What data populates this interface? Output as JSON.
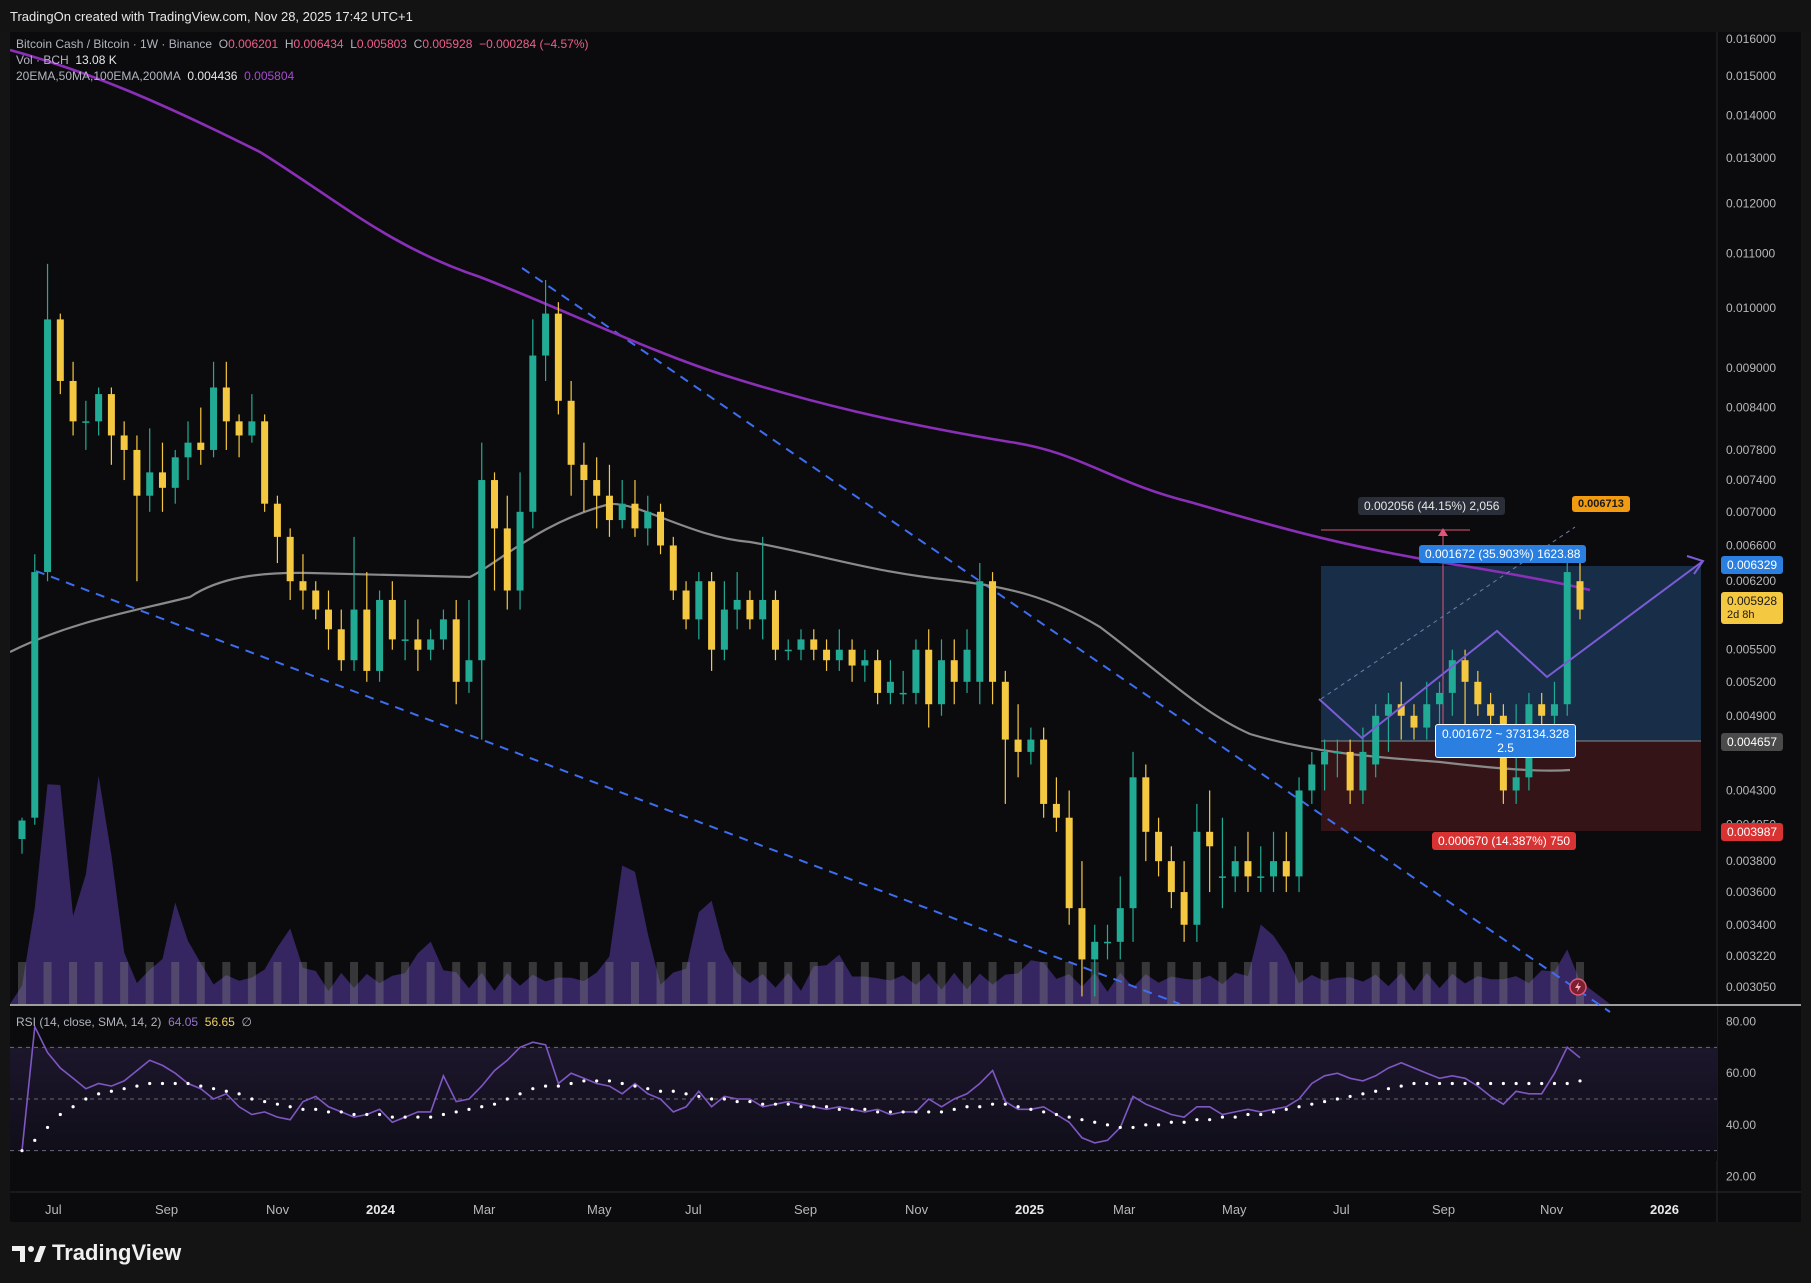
{
  "header": {
    "caption": "TradingOn created with TradingView.com, Nov 28, 2025 17:42 UTC+1"
  },
  "legend": {
    "symbol": "Bitcoin Cash / Bitcoin · 1W · Binance",
    "o_label": "O",
    "o_value": "0.006201",
    "h_label": "H",
    "h_value": "0.006434",
    "l_label": "L",
    "l_value": "0.005803",
    "c_label": "C",
    "c_value": "0.005928",
    "change": "−0.000284 (−4.57%)",
    "vol_label": "Vol · BCH",
    "vol_value": "13.08 K",
    "ma_label": "20EMA,50MA,100EMA,200MA",
    "ma_value1": "0.004436",
    "ma_value2": "0.005804",
    "rsi_label": "RSI (14, close, SMA, 14, 2)",
    "rsi_value": "64.05",
    "rsi_sma": "56.65",
    "rsi_extra": "∅"
  },
  "tags": {
    "range_top": "0.002056 (44.15%) 2,056",
    "target_price": "0.006713",
    "target_box": "0.001672 (35.903%) 1623.88",
    "ratio_line1": "0.001672 ~ 373134.328",
    "ratio_line2": "2.5",
    "stop_box": "0.000670 (14.387%) 750",
    "price_6329": "0.006329",
    "price_last": "0.005928",
    "countdown": "2d 8h",
    "price_4657": "0.004657",
    "price_3987": "0.003987"
  },
  "brand": {
    "name": "TradingView"
  },
  "colors": {
    "up": "#22ab94",
    "down": "#f5c842",
    "ma_purple": "#8b2fb8",
    "ma_grey": "#8a8a8a",
    "trend_blue": "#3d6ef0",
    "rsi": "#7e57c2",
    "target_zone": "#1e3b5c",
    "stop_zone": "#3a1518"
  },
  "chart_data": {
    "type": "candlestick",
    "price_scale": "log",
    "ylim": [
      0.00296,
      0.0162
    ],
    "y_ticks": [
      "0.016000",
      "0.015000",
      "0.014000",
      "0.013000",
      "0.012000",
      "0.011000",
      "0.010000",
      "0.009000",
      "0.008400",
      "0.007800",
      "0.007400",
      "0.007000",
      "0.006600",
      "0.006200",
      "0.005500",
      "0.005200",
      "0.004900",
      "0.004300",
      "0.004050",
      "0.003800",
      "0.003600",
      "0.003400",
      "0.003220",
      "0.003050"
    ],
    "x_ticks": [
      "Jul",
      "Sep",
      "Nov",
      "2024",
      "Mar",
      "May",
      "Jul",
      "Sep",
      "Nov",
      "2025",
      "Mar",
      "May",
      "Jul",
      "Sep",
      "Nov",
      "2026"
    ],
    "rsi_ticks": [
      "80.00",
      "60.00",
      "40.00",
      "20.00"
    ],
    "candles": [
      [
        0.00395,
        0.00408,
        0.00385,
        0.0041
      ],
      [
        0.0041,
        0.0063,
        0.00405,
        0.0065
      ],
      [
        0.0063,
        0.0098,
        0.0062,
        0.0108
      ],
      [
        0.0098,
        0.0088,
        0.0086,
        0.0099
      ],
      [
        0.0088,
        0.0082,
        0.008,
        0.0091
      ],
      [
        0.0082,
        0.0082,
        0.0078,
        0.0085
      ],
      [
        0.0082,
        0.0086,
        0.008,
        0.0087
      ],
      [
        0.0086,
        0.008,
        0.0076,
        0.0087
      ],
      [
        0.008,
        0.0078,
        0.0074,
        0.0082
      ],
      [
        0.0078,
        0.0072,
        0.0062,
        0.008
      ],
      [
        0.0072,
        0.0075,
        0.007,
        0.0081
      ],
      [
        0.0075,
        0.0073,
        0.007,
        0.0079
      ],
      [
        0.0073,
        0.0077,
        0.0071,
        0.0078
      ],
      [
        0.0077,
        0.0079,
        0.0074,
        0.0082
      ],
      [
        0.0079,
        0.0078,
        0.0076,
        0.0084
      ],
      [
        0.0078,
        0.0087,
        0.0077,
        0.0091
      ],
      [
        0.0087,
        0.0082,
        0.0078,
        0.0091
      ],
      [
        0.0082,
        0.008,
        0.0077,
        0.0083
      ],
      [
        0.008,
        0.0082,
        0.0079,
        0.0086
      ],
      [
        0.0082,
        0.0071,
        0.007,
        0.0083
      ],
      [
        0.0071,
        0.0067,
        0.0064,
        0.0072
      ],
      [
        0.0067,
        0.0062,
        0.006,
        0.0068
      ],
      [
        0.0062,
        0.0061,
        0.0059,
        0.0065
      ],
      [
        0.0061,
        0.0059,
        0.0058,
        0.0062
      ],
      [
        0.0059,
        0.0057,
        0.0055,
        0.0061
      ],
      [
        0.0057,
        0.0054,
        0.0053,
        0.0059
      ],
      [
        0.0054,
        0.0059,
        0.0053,
        0.0067
      ],
      [
        0.0059,
        0.0053,
        0.0052,
        0.0063
      ],
      [
        0.0053,
        0.006,
        0.0052,
        0.0061
      ],
      [
        0.006,
        0.0056,
        0.0055,
        0.0062
      ],
      [
        0.0056,
        0.0056,
        0.0054,
        0.006
      ],
      [
        0.0056,
        0.0055,
        0.0053,
        0.0058
      ],
      [
        0.0055,
        0.0056,
        0.0054,
        0.0057
      ],
      [
        0.0056,
        0.0058,
        0.0055,
        0.0059
      ],
      [
        0.0058,
        0.0052,
        0.005,
        0.006
      ],
      [
        0.0052,
        0.0054,
        0.0051,
        0.006
      ],
      [
        0.0054,
        0.0074,
        0.0047,
        0.0079
      ],
      [
        0.0074,
        0.0068,
        0.0061,
        0.0075
      ],
      [
        0.0068,
        0.0061,
        0.0059,
        0.0072
      ],
      [
        0.0061,
        0.007,
        0.0059,
        0.0075
      ],
      [
        0.007,
        0.0092,
        0.0068,
        0.0098
      ],
      [
        0.0092,
        0.0099,
        0.0088,
        0.0105
      ],
      [
        0.0099,
        0.0085,
        0.0083,
        0.0101
      ],
      [
        0.0085,
        0.0076,
        0.0072,
        0.0088
      ],
      [
        0.0076,
        0.0074,
        0.007,
        0.0079
      ],
      [
        0.0074,
        0.0072,
        0.0068,
        0.0077
      ],
      [
        0.0072,
        0.0069,
        0.0067,
        0.0076
      ],
      [
        0.0069,
        0.0071,
        0.0068,
        0.0074
      ],
      [
        0.0071,
        0.0068,
        0.0067,
        0.0074
      ],
      [
        0.0068,
        0.007,
        0.0066,
        0.0072
      ],
      [
        0.007,
        0.0066,
        0.0065,
        0.0071
      ],
      [
        0.0066,
        0.0061,
        0.006,
        0.0067
      ],
      [
        0.0061,
        0.0058,
        0.0057,
        0.0062
      ],
      [
        0.0058,
        0.0062,
        0.0056,
        0.0063
      ],
      [
        0.0062,
        0.0055,
        0.0053,
        0.0063
      ],
      [
        0.0055,
        0.0059,
        0.0054,
        0.0062
      ],
      [
        0.0059,
        0.006,
        0.0057,
        0.0063
      ],
      [
        0.006,
        0.0058,
        0.0057,
        0.0061
      ],
      [
        0.0058,
        0.006,
        0.0056,
        0.0067
      ],
      [
        0.006,
        0.0055,
        0.0054,
        0.0061
      ],
      [
        0.0055,
        0.0055,
        0.0054,
        0.0056
      ],
      [
        0.0055,
        0.0056,
        0.0054,
        0.0057
      ],
      [
        0.0056,
        0.0055,
        0.0054,
        0.0057
      ],
      [
        0.0055,
        0.0054,
        0.0053,
        0.0056
      ],
      [
        0.0054,
        0.0055,
        0.0053,
        0.0057
      ],
      [
        0.0055,
        0.00535,
        0.0052,
        0.0056
      ],
      [
        0.00535,
        0.0054,
        0.0052,
        0.0055
      ],
      [
        0.0054,
        0.0051,
        0.005,
        0.0055
      ],
      [
        0.0051,
        0.0052,
        0.005,
        0.0054
      ],
      [
        0.0051,
        0.0051,
        0.005,
        0.0053
      ],
      [
        0.0051,
        0.0055,
        0.005,
        0.0056
      ],
      [
        0.0055,
        0.005,
        0.0048,
        0.0057
      ],
      [
        0.005,
        0.0054,
        0.0049,
        0.0056
      ],
      [
        0.0054,
        0.0052,
        0.005,
        0.0056
      ],
      [
        0.0052,
        0.0055,
        0.0051,
        0.0057
      ],
      [
        0.0052,
        0.0062,
        0.005,
        0.0064
      ],
      [
        0.0062,
        0.0052,
        0.005,
        0.0063
      ],
      [
        0.0052,
        0.0047,
        0.0042,
        0.0053
      ],
      [
        0.0047,
        0.0046,
        0.0044,
        0.005
      ],
      [
        0.0046,
        0.0047,
        0.0045,
        0.0048
      ],
      [
        0.0047,
        0.0042,
        0.0041,
        0.0048
      ],
      [
        0.0042,
        0.0041,
        0.004,
        0.0044
      ],
      [
        0.0041,
        0.0035,
        0.0034,
        0.0043
      ],
      [
        0.0035,
        0.0032,
        0.003,
        0.0038
      ],
      [
        0.0032,
        0.0033,
        0.003,
        0.0034
      ],
      [
        0.0033,
        0.0033,
        0.0032,
        0.0034
      ],
      [
        0.0033,
        0.0035,
        0.0032,
        0.0037
      ],
      [
        0.0035,
        0.0044,
        0.0033,
        0.0046
      ],
      [
        0.0044,
        0.004,
        0.0038,
        0.0045
      ],
      [
        0.004,
        0.0038,
        0.0037,
        0.0041
      ],
      [
        0.0038,
        0.0036,
        0.0035,
        0.0039
      ],
      [
        0.0036,
        0.0034,
        0.0033,
        0.0038
      ],
      [
        0.0034,
        0.004,
        0.0033,
        0.0042
      ],
      [
        0.004,
        0.0039,
        0.0036,
        0.0043
      ],
      [
        0.0037,
        0.0037,
        0.0035,
        0.0041
      ],
      [
        0.0037,
        0.0038,
        0.0036,
        0.0039
      ],
      [
        0.0038,
        0.0037,
        0.0036,
        0.004
      ],
      [
        0.0037,
        0.0037,
        0.0036,
        0.0039
      ],
      [
        0.0037,
        0.0038,
        0.0036,
        0.004
      ],
      [
        0.0038,
        0.0037,
        0.0036,
        0.004
      ],
      [
        0.0037,
        0.0043,
        0.0036,
        0.0044
      ],
      [
        0.0043,
        0.0045,
        0.0042,
        0.0046
      ],
      [
        0.0045,
        0.0046,
        0.0043,
        0.0047
      ],
      [
        0.0046,
        0.0046,
        0.0044,
        0.0047
      ],
      [
        0.0046,
        0.0043,
        0.0042,
        0.0047
      ],
      [
        0.0043,
        0.0046,
        0.0042,
        0.0048
      ],
      [
        0.0045,
        0.0049,
        0.0044,
        0.005
      ],
      [
        0.0049,
        0.005,
        0.0046,
        0.0051
      ],
      [
        0.005,
        0.0049,
        0.0047,
        0.0052
      ],
      [
        0.0049,
        0.0048,
        0.0047,
        0.005
      ],
      [
        0.0048,
        0.005,
        0.0047,
        0.0052
      ],
      [
        0.005,
        0.0051,
        0.0048,
        0.0052
      ],
      [
        0.0051,
        0.0054,
        0.0049,
        0.0055
      ],
      [
        0.0054,
        0.0052,
        0.0047,
        0.0055
      ],
      [
        0.0052,
        0.005,
        0.0049,
        0.0053
      ],
      [
        0.005,
        0.0049,
        0.0047,
        0.0051
      ],
      [
        0.0049,
        0.0043,
        0.0042,
        0.005
      ],
      [
        0.0043,
        0.0044,
        0.0042,
        0.005
      ],
      [
        0.0044,
        0.005,
        0.0043,
        0.0051
      ],
      [
        0.005,
        0.0049,
        0.0047,
        0.0051
      ],
      [
        0.0049,
        0.005,
        0.0047,
        0.0052
      ],
      [
        0.005,
        0.0063,
        0.0049,
        0.0064
      ],
      [
        0.0062,
        0.0059,
        0.0058,
        0.0064
      ]
    ],
    "volume_peaks": [
      [
        0.02,
        0.95
      ],
      [
        0.05,
        0.85
      ],
      [
        0.1,
        0.3
      ],
      [
        0.17,
        0.2
      ],
      [
        0.26,
        0.15
      ],
      [
        0.39,
        0.55
      ],
      [
        0.44,
        0.35
      ],
      [
        0.52,
        0.1
      ],
      [
        0.65,
        0.08
      ],
      [
        0.8,
        0.25
      ],
      [
        0.99,
        0.1
      ]
    ],
    "rsi_values": [
      30,
      78,
      68,
      62,
      58,
      54,
      56,
      55,
      57,
      61,
      65,
      63,
      60,
      56,
      54,
      50,
      52,
      47,
      44,
      45,
      43,
      42,
      49,
      51,
      47,
      45,
      43,
      44,
      46,
      41,
      43,
      45,
      45,
      59,
      49,
      50,
      55,
      61,
      65,
      70,
      72,
      71,
      56,
      60,
      58,
      56,
      55,
      52,
      56,
      52,
      50,
      45,
      47,
      53,
      47,
      51,
      50,
      50,
      47,
      48,
      49,
      48,
      47,
      46,
      47,
      46,
      45,
      46,
      44,
      45,
      45,
      50,
      47,
      50,
      52,
      56,
      61,
      49,
      46,
      46,
      47,
      44,
      41,
      35,
      33,
      34,
      39,
      51,
      48,
      46,
      44,
      43,
      47,
      47,
      44,
      45,
      46,
      45,
      46,
      47,
      50,
      56,
      59,
      60,
      58,
      57,
      59,
      62,
      64,
      62,
      60,
      58,
      59,
      58,
      55,
      51,
      48,
      53,
      52,
      52,
      60,
      70,
      66
    ],
    "rsi_sma_values": [
      30,
      34,
      39,
      44,
      47,
      50,
      52,
      53,
      54,
      55,
      56,
      56,
      56,
      56,
      55,
      54,
      53,
      52,
      50,
      49,
      48,
      47,
      46,
      46,
      45,
      45,
      44,
      44,
      44,
      43,
      43,
      43,
      43,
      44,
      45,
      46,
      47,
      48,
      50,
      52,
      54,
      55,
      55,
      56,
      57,
      57,
      57,
      56,
      55,
      54,
      53,
      53,
      52,
      51,
      50,
      50,
      49,
      49,
      48,
      48,
      48,
      47,
      47,
      47,
      46,
      46,
      46,
      45,
      45,
      45,
      45,
      45,
      45,
      46,
      47,
      47,
      48,
      48,
      47,
      46,
      45,
      44,
      43,
      42,
      41,
      40,
      39,
      39,
      40,
      40,
      41,
      41,
      42,
      42,
      43,
      43,
      44,
      44,
      45,
      46,
      47,
      48,
      49,
      50,
      51,
      52,
      53,
      54,
      55,
      56,
      56,
      56,
      56,
      56,
      56,
      56,
      56,
      56,
      56,
      56,
      56,
      56,
      57
    ]
  }
}
